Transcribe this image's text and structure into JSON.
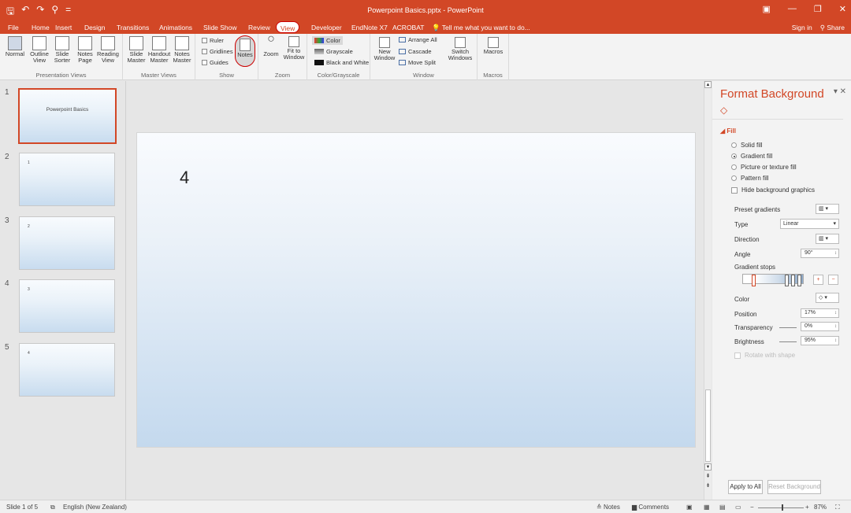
{
  "titlebar": {
    "document_title": "Powerpoint Basics.pptx - PowerPoint",
    "qat": {
      "save": "🖫",
      "undo": "↶",
      "redo": "↷",
      "customize": "⚲",
      "more": "="
    },
    "controls": {
      "ribbon_options": "▣",
      "minimize": "—",
      "restore": "❐",
      "close": "✕"
    }
  },
  "tabs": [
    "File",
    "Home",
    "Insert",
    "Design",
    "Transitions",
    "Animations",
    "Slide Show",
    "Review",
    "View",
    "Developer",
    "EndNote X7",
    "ACROBAT"
  ],
  "active_tab": "View",
  "tell_me": "Tell me what you want to do...",
  "sign_in": "Sign in",
  "share": "Share",
  "ribbon": {
    "presentation_views": {
      "label": "Presentation Views",
      "buttons": [
        {
          "l1": "Normal",
          "l2": ""
        },
        {
          "l1": "Outline",
          "l2": "View"
        },
        {
          "l1": "Slide",
          "l2": "Sorter"
        },
        {
          "l1": "Notes",
          "l2": "Page"
        },
        {
          "l1": "Reading",
          "l2": "View"
        }
      ]
    },
    "master_views": {
      "label": "Master Views",
      "buttons": [
        {
          "l1": "Slide",
          "l2": "Master"
        },
        {
          "l1": "Handout",
          "l2": "Master"
        },
        {
          "l1": "Notes",
          "l2": "Master"
        }
      ]
    },
    "show": {
      "label": "Show",
      "ruler": "Ruler",
      "gridlines": "Gridlines",
      "guides": "Guides",
      "notes": "Notes"
    },
    "zoom": {
      "label": "Zoom",
      "zoom": "Zoom",
      "fit1": "Fit to",
      "fit2": "Window"
    },
    "color": {
      "label": "Color/Grayscale",
      "color": "Color",
      "grayscale": "Grayscale",
      "bw": "Black and White"
    },
    "window": {
      "label": "Window",
      "new1": "New",
      "new2": "Window",
      "arrange": "Arrange All",
      "cascade": "Cascade",
      "move_split": "Move Split",
      "switch1": "Switch",
      "switch2": "Windows"
    },
    "macros": {
      "label": "Macros",
      "macros": "Macros"
    }
  },
  "slides": [
    {
      "num": "1",
      "title": "Powerpoint Basics"
    },
    {
      "num": "2",
      "text": "1"
    },
    {
      "num": "3",
      "text": "2"
    },
    {
      "num": "4",
      "text": "3"
    },
    {
      "num": "5",
      "text": "4"
    }
  ],
  "slide_text": "4",
  "format_background": {
    "title": "Format Background",
    "section": "Fill",
    "options": [
      "Solid fill",
      "Gradient fill",
      "Picture or texture fill",
      "Pattern fill"
    ],
    "selected_option": "Gradient fill",
    "hide_background": "Hide background graphics",
    "preset_gradients": "Preset gradients",
    "type_label": "Type",
    "type_value": "Linear",
    "direction": "Direction",
    "angle_label": "Angle",
    "angle_value": "90°",
    "gradient_stops": "Gradient stops",
    "color_label": "Color",
    "position_label": "Position",
    "position_value": "17%",
    "transparency_label": "Transparency",
    "transparency_value": "0%",
    "brightness_label": "Brightness",
    "brightness_value": "95%",
    "rotate": "Rotate with shape",
    "apply_all": "Apply to All",
    "reset": "Reset Background"
  },
  "status": {
    "slide": "Slide 1 of 5",
    "language": "English (New Zealand)",
    "notes": "Notes",
    "comments": "Comments",
    "zoom": "87%"
  },
  "colors": {
    "accent": "#d24726",
    "ribbon": "#f3f3f3",
    "workspace": "#e6e6e6"
  }
}
